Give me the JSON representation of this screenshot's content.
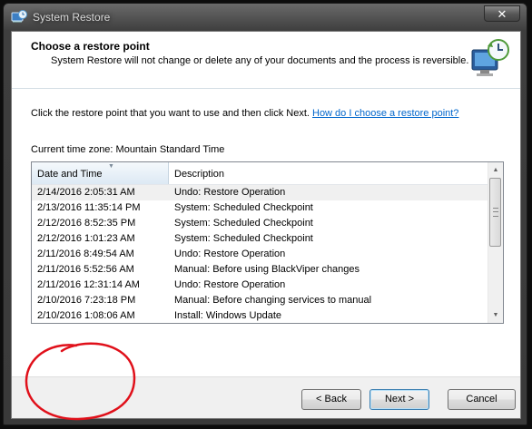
{
  "window": {
    "title": "System Restore",
    "close_glyph": "✕"
  },
  "header": {
    "title": "Choose a restore point",
    "description": "System Restore will not change or delete any of your documents and the process is reversible."
  },
  "instruction": {
    "text": "Click the restore point that you want to use and then click Next.",
    "help_link": "How do I choose a restore point?"
  },
  "timezone": "Current time zone: Mountain Standard Time",
  "table": {
    "columns": [
      "Date and Time",
      "Description"
    ],
    "rows": [
      {
        "date": "2/14/2016 2:05:31 AM",
        "desc": "Undo: Restore Operation"
      },
      {
        "date": "2/13/2016 11:35:14 PM",
        "desc": "System: Scheduled Checkpoint"
      },
      {
        "date": "2/12/2016 8:52:35 PM",
        "desc": "System: Scheduled Checkpoint"
      },
      {
        "date": "2/12/2016 1:01:23 AM",
        "desc": "System: Scheduled Checkpoint"
      },
      {
        "date": "2/11/2016 8:49:54 AM",
        "desc": "Undo: Restore Operation"
      },
      {
        "date": "2/11/2016 5:52:56 AM",
        "desc": "Manual: Before using BlackViper changes"
      },
      {
        "date": "2/11/2016 12:31:14 AM",
        "desc": "Undo: Restore Operation"
      },
      {
        "date": "2/10/2016 7:23:18 PM",
        "desc": "Manual: Before changing services to manual"
      },
      {
        "date": "2/10/2016 1:08:06 AM",
        "desc": "Install: Windows Update"
      }
    ]
  },
  "buttons": {
    "back": "< Back",
    "next": "Next >",
    "cancel": "Cancel"
  },
  "icons": {
    "title": "system-restore-icon",
    "header": "restore-clock-icon"
  },
  "colors": {
    "link": "#0066cc",
    "annotation": "#e0101a"
  }
}
